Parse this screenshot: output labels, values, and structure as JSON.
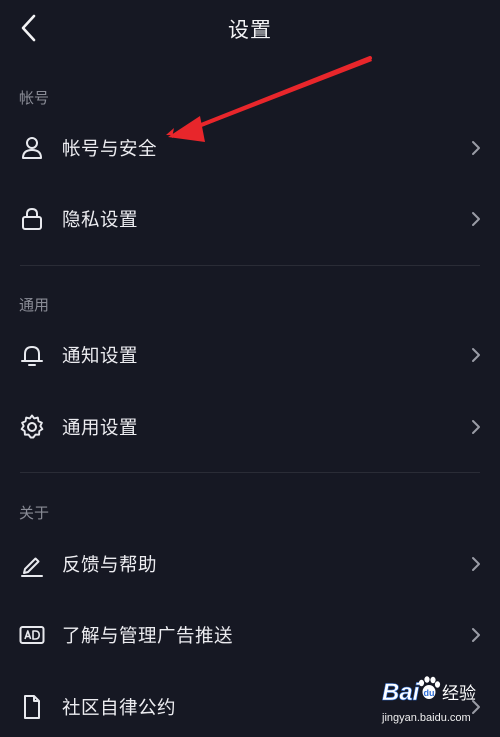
{
  "header": {
    "title": "设置"
  },
  "sections": {
    "account": {
      "label": "帐号",
      "items": [
        {
          "label": "帐号与安全",
          "icon": "user-icon"
        },
        {
          "label": "隐私设置",
          "icon": "lock-icon"
        }
      ]
    },
    "general": {
      "label": "通用",
      "items": [
        {
          "label": "通知设置",
          "icon": "bell-icon"
        },
        {
          "label": "通用设置",
          "icon": "gear-icon"
        }
      ]
    },
    "about": {
      "label": "关于",
      "items": [
        {
          "label": "反馈与帮助",
          "icon": "pencil-icon"
        },
        {
          "label": "了解与管理广告推送",
          "icon": "ad-icon"
        },
        {
          "label": "社区自律公约",
          "icon": "document-icon"
        }
      ]
    }
  },
  "watermark": {
    "brand": "Bai",
    "brand_tail": "du",
    "suffix": "经验",
    "url": "jingyan.baidu.com"
  },
  "colors": {
    "background": "#161823",
    "annotation_arrow": "#e8262b",
    "section_label": "#8a8c96",
    "divider": "#2a2c36"
  }
}
